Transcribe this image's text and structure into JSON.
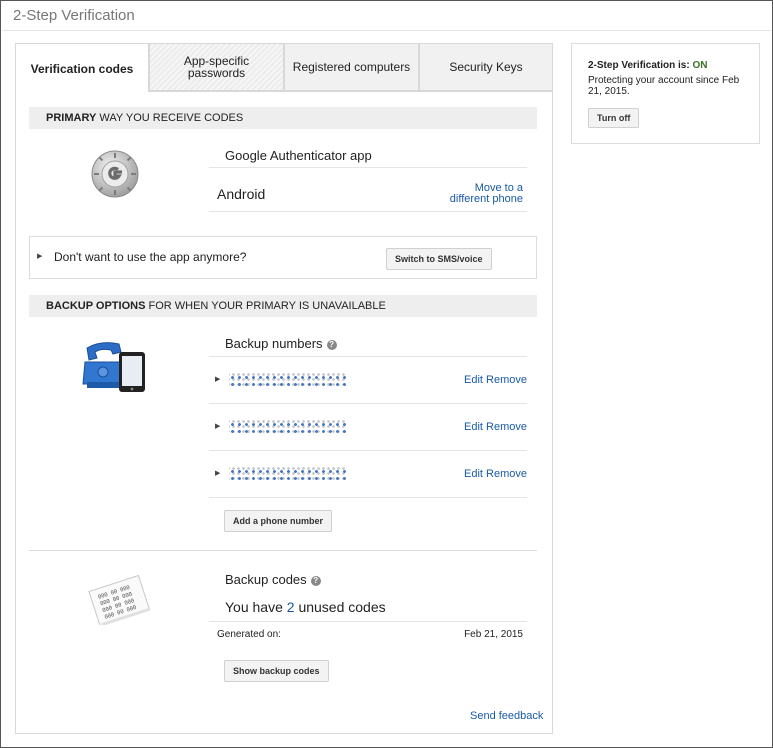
{
  "page": {
    "title": "2-Step Verification"
  },
  "tabs": [
    {
      "label": "Verification codes",
      "active": true
    },
    {
      "label": "App-specific passwords",
      "active": false
    },
    {
      "label": "Registered computers",
      "active": false
    },
    {
      "label": "Security Keys",
      "active": false
    }
  ],
  "primary": {
    "header_bold": "PRIMARY",
    "header_rest": " WAY YOU RECEIVE CODES",
    "app_name": "Google Authenticator app",
    "device": "Android",
    "move_link": "Move to a different phone",
    "icon": "google-authenticator-icon",
    "no_app_prompt": "Don't want to use the app anymore?",
    "switch_button": "Switch to SMS/voice"
  },
  "backup": {
    "header_bold": "BACKUP OPTIONS",
    "header_rest": " FOR WHEN YOUR PRIMARY IS UNAVAILABLE",
    "icon": "phone-and-tablet-icon",
    "numbers_title": "Backup numbers",
    "numbers": [
      {
        "edit": "Edit",
        "remove": "Remove"
      },
      {
        "edit": "Edit",
        "remove": "Remove"
      },
      {
        "edit": "Edit",
        "remove": "Remove"
      }
    ],
    "add_button": "Add a phone number"
  },
  "codes": {
    "icon": "backup-codes-sheet-icon",
    "title": "Backup codes",
    "unused_prefix": "You have ",
    "unused_count": "2",
    "unused_suffix": " unused codes",
    "generated_label": "Generated on:",
    "generated_date": "Feb 21, 2015",
    "show_button": "Show backup codes",
    "sheet_lines": [
      "000 00 000",
      "000 00 000",
      "000 00 000",
      "000 00 000"
    ]
  },
  "feedback_link": "Send feedback",
  "status": {
    "title_prefix": "2-Step Verification is: ",
    "state": "ON",
    "since": "Protecting your account since Feb 21, 2015.",
    "turn_off_button": "Turn off"
  },
  "colors": {
    "link": "#1a5aa5",
    "on": "#3a6f27",
    "help_icon": "#888888"
  }
}
